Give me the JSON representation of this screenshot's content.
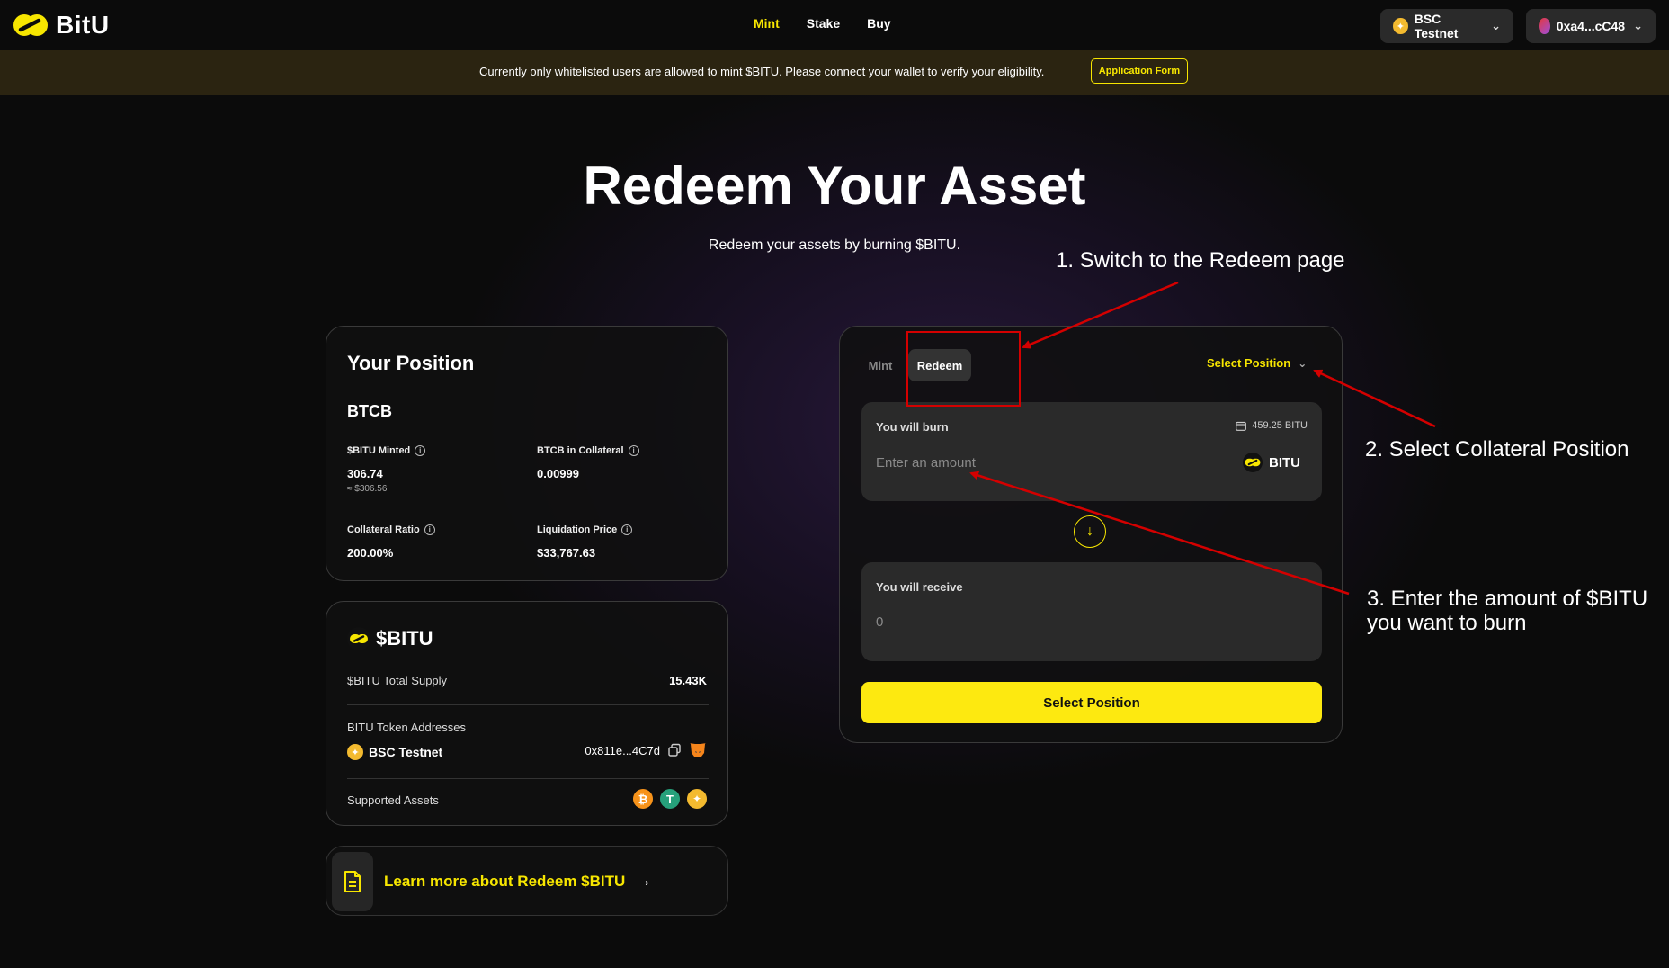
{
  "brand": {
    "name": "BitU"
  },
  "nav": {
    "links": [
      "Mint",
      "Stake",
      "Buy"
    ],
    "active": "Mint"
  },
  "network": {
    "label": "BSC Testnet"
  },
  "wallet": {
    "address": "0xa4...cC48"
  },
  "banner": {
    "text": "Currently only whitelisted users are allowed to mint $BITU. Please connect your wallet to verify your eligibility.",
    "button": "Application Form"
  },
  "hero": {
    "title": "Redeem Your Asset",
    "subtitle": "Redeem your assets by burning $BITU."
  },
  "position": {
    "title": "Your Position",
    "asset": "BTCB",
    "minted_label": "$BITU Minted",
    "minted_value": "306.74",
    "minted_usd": "≈ $306.56",
    "collateral_label": "BTCB in Collateral",
    "collateral_value": "0.00999",
    "ratio_label": "Collateral Ratio",
    "ratio_value": "200.00%",
    "liq_label": "Liquidation Price",
    "liq_value": "$33,767.63"
  },
  "token_card": {
    "title": "$BITU",
    "supply_label": "$BITU Total Supply",
    "supply_value": "15.43K",
    "addresses_label": "BITU Token Addresses",
    "network": "BSC Testnet",
    "address": "0x811e...4C7d",
    "assets_label": "Supported Assets"
  },
  "learn": {
    "text": "Learn more about Redeem $BITU"
  },
  "swap": {
    "tab_mint": "Mint",
    "tab_redeem": "Redeem",
    "select_position": "Select Position",
    "burn_label": "You will burn",
    "balance": "459.25 BITU",
    "amount_placeholder": "Enter an amount",
    "token": "BITU",
    "receive_label": "You will receive",
    "receive_value": "0",
    "cta": "Select Position"
  },
  "annotations": {
    "step1": "1. Switch to the Redeem page",
    "step2": "2. Select Collateral Position",
    "step3_line1": "3. Enter the amount of $BITU",
    "step3_line2": "you want to burn"
  },
  "colors": {
    "accent": "#f7e600",
    "cta": "#fde910",
    "annotation": "#d40000",
    "background": "#0b0b0b"
  }
}
